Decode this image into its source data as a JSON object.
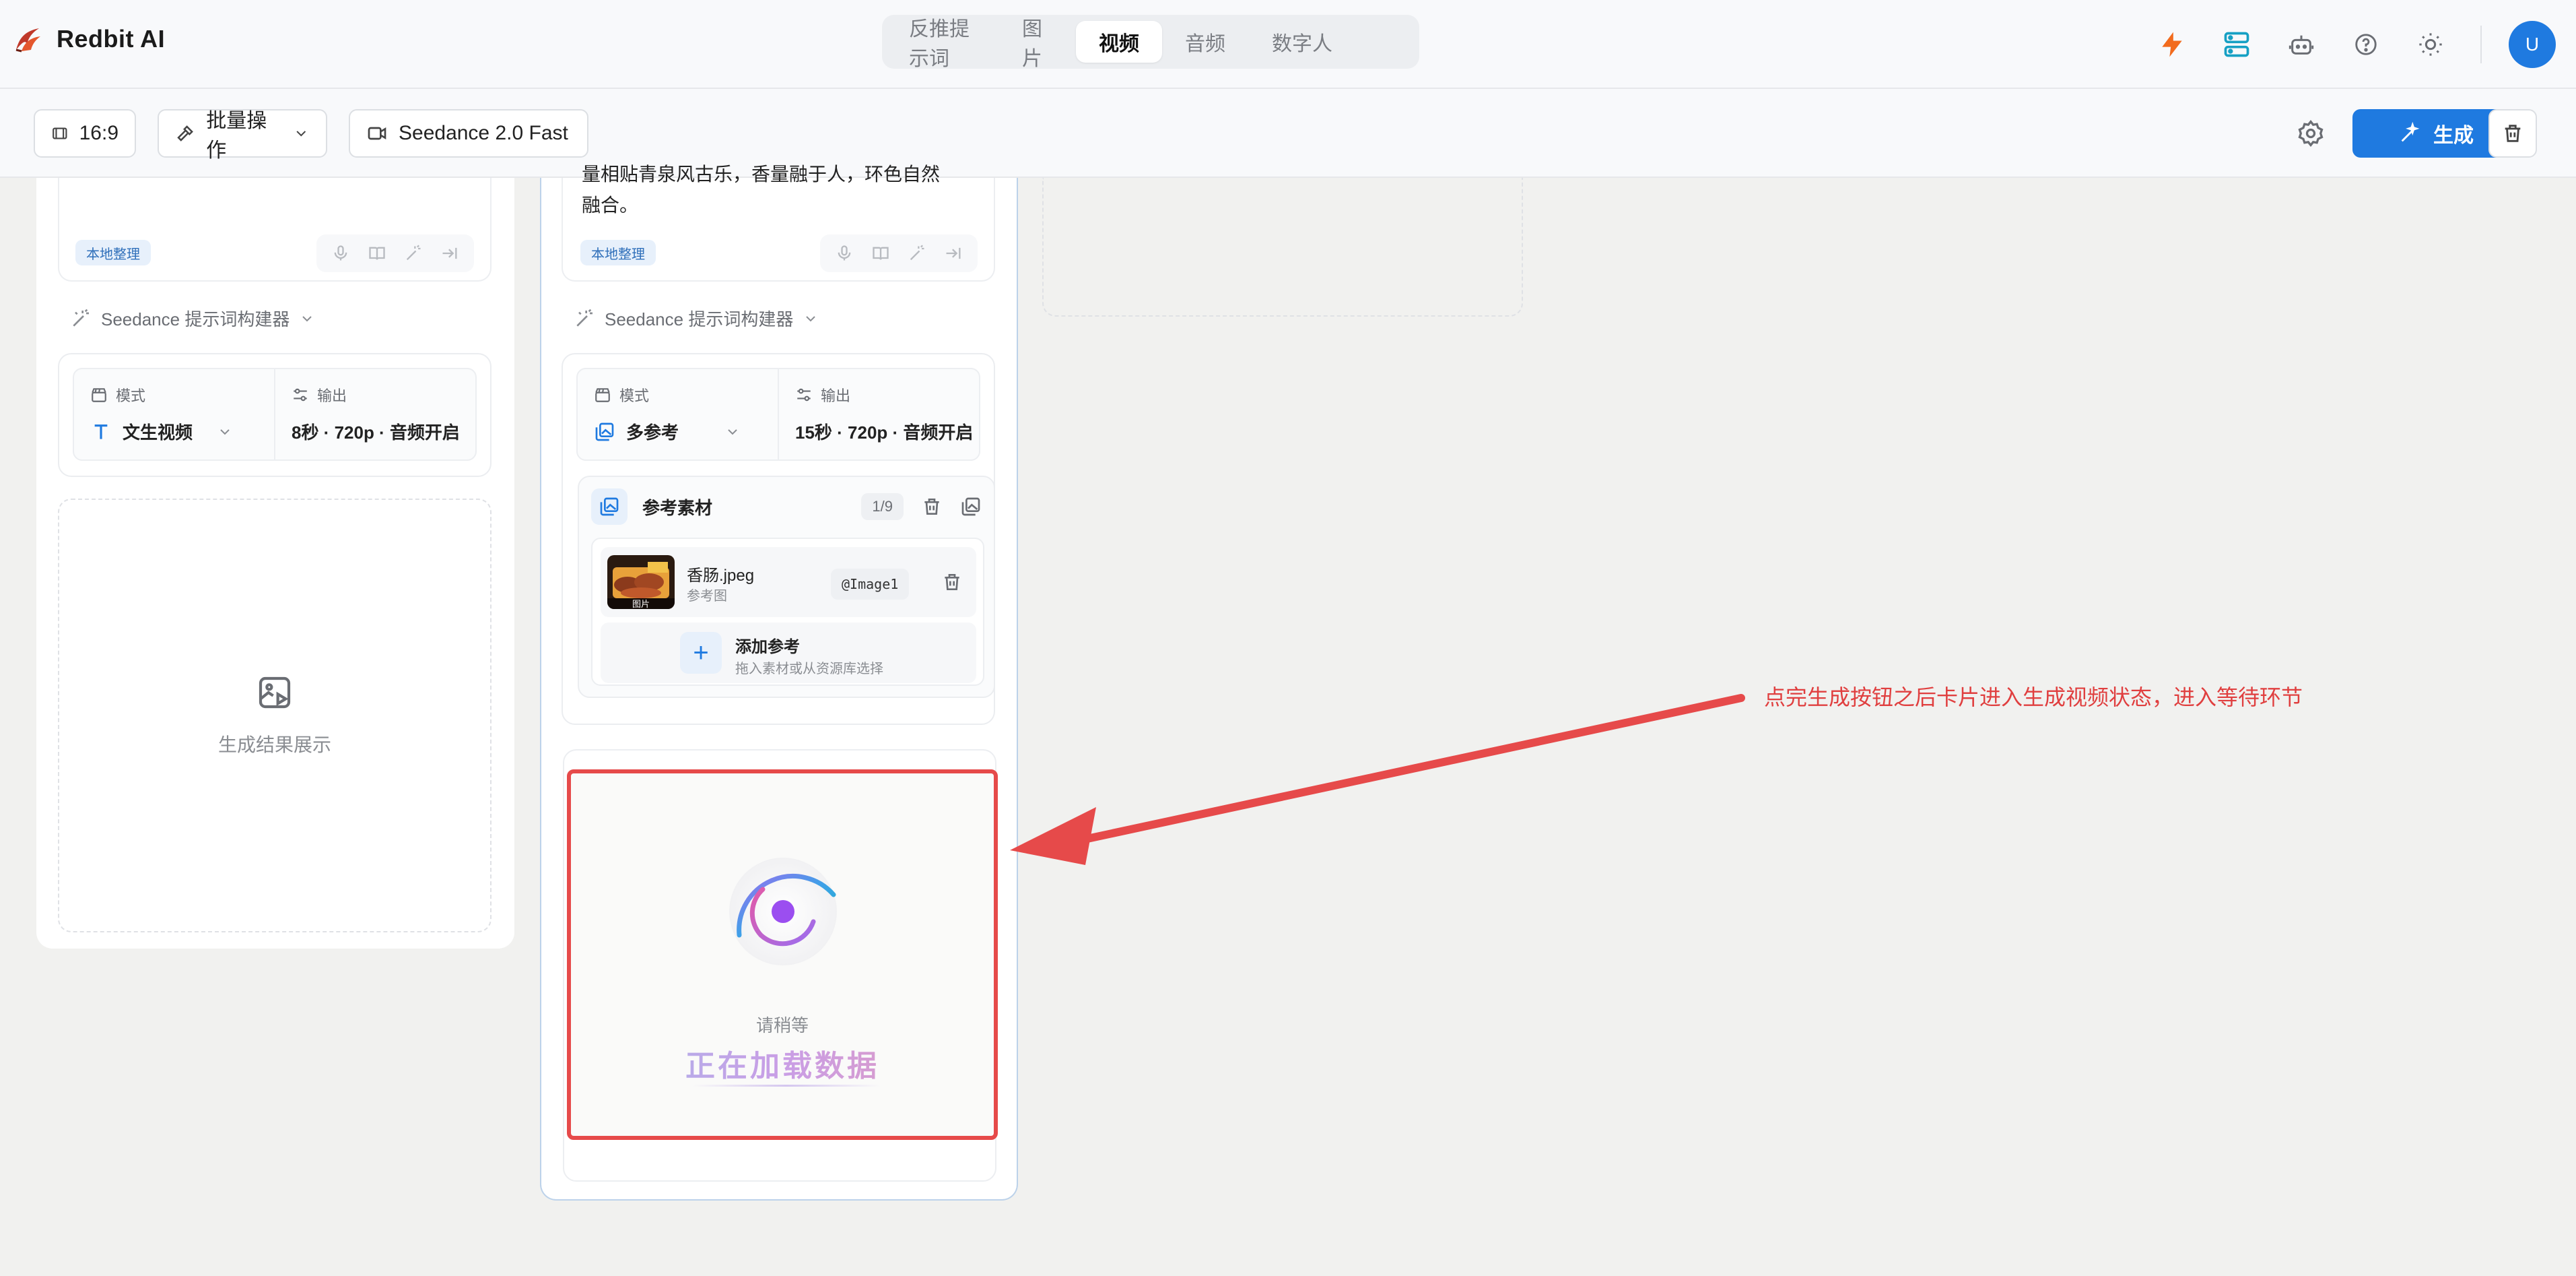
{
  "app": {
    "title": "Redbit AI"
  },
  "nav": {
    "tabs": [
      "反推提示词",
      "图片",
      "视频",
      "音频",
      "数字人"
    ],
    "active": 2
  },
  "header": {
    "avatar_letter": "U"
  },
  "toolbar": {
    "ratio": "16:9",
    "batch_label": "批量操作",
    "model": "Seedance 2.0 Fast",
    "generate_label": "生成"
  },
  "left_card": {
    "tag": "本地整理",
    "builder": "Seedance 提示词构建器",
    "mode_label": "模式",
    "mode_value": "文生视频",
    "output_label": "输出",
    "output_value": "8秒 · 720p · 音频开启",
    "placeholder": "生成结果展示"
  },
  "mid_card": {
    "desc_line1": "量相贴青泉风古乐，香量融于人，环色自然",
    "desc_line2": "融合。",
    "tag": "本地整理",
    "builder": "Seedance 提示词构建器",
    "mode_label": "模式",
    "mode_value": "多参考",
    "output_label": "输出",
    "output_value": "15秒 · 720p · 音频开启",
    "ref_title": "参考素材",
    "ref_count": "1/9",
    "file": {
      "name": "香肠.jpeg",
      "sub": "参考图",
      "badge": "图片",
      "ref": "@Image1"
    },
    "add": {
      "title": "添加参考",
      "sub": "拖入素材或从资源库选择"
    },
    "loading": {
      "wait": "请稍等",
      "text": "正在加载数据"
    }
  },
  "annotation": "点完生成按钮之后卡片进入生成视频状态，进入等待环节",
  "colors": {
    "accent": "#1f7ae0",
    "highlight": "#e64a4a",
    "annotation": "#e03f3f"
  }
}
